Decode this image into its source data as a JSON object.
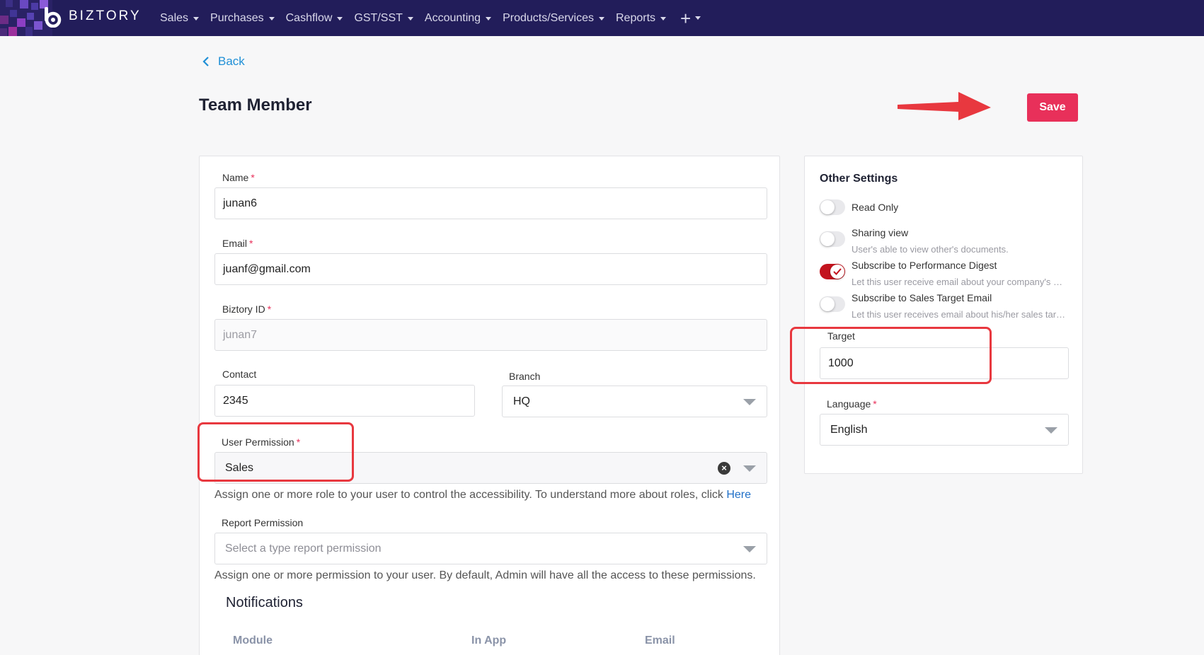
{
  "brand": {
    "name": "BIZTORY"
  },
  "nav": {
    "items": [
      {
        "label": "Sales"
      },
      {
        "label": "Purchases"
      },
      {
        "label": "Cashflow"
      },
      {
        "label": "GST/SST"
      },
      {
        "label": "Accounting"
      },
      {
        "label": "Products/Services"
      },
      {
        "label": "Reports"
      }
    ],
    "plus": "+"
  },
  "page": {
    "back_label": "Back",
    "title": "Team Member",
    "save_label": "Save"
  },
  "form": {
    "name": {
      "label": "Name",
      "required": "*",
      "value": "junan6"
    },
    "email": {
      "label": "Email",
      "required": "*",
      "value": "juanf@gmail.com"
    },
    "biztory_id": {
      "label": "Biztory ID",
      "required": "*",
      "value": "junan7"
    },
    "contact": {
      "label": "Contact",
      "value": "2345"
    },
    "branch": {
      "label": "Branch",
      "value": "HQ"
    },
    "user_permission": {
      "label": "User Permission",
      "required": "*",
      "value": "Sales",
      "help": "Assign one or more role to your user to control the accessibility. To understand more about roles, click ",
      "help_link": "Here"
    },
    "report_permission": {
      "label": "Report Permission",
      "placeholder": "Select a type report permission",
      "help": "Assign one or more permission to your user. By default, Admin will have all the access to these permissions."
    },
    "notifications": {
      "title": "Notifications",
      "columns": [
        "Module",
        "In App",
        "Email"
      ]
    }
  },
  "other_settings": {
    "title": "Other Settings",
    "options": [
      {
        "label": "Read Only",
        "description": "",
        "enabled": false
      },
      {
        "label": "Sharing view",
        "description": "User's able to view other's documents.",
        "enabled": false
      },
      {
        "label": "Subscribe to Performance Digest",
        "description": "Let this user receive email about your company's performance.",
        "enabled": true
      },
      {
        "label": "Subscribe to Sales Target Email",
        "description": "Let this user receives email about his/her sales target.",
        "enabled": false
      }
    ],
    "target": {
      "label": "Target",
      "value": "1000"
    },
    "language": {
      "label": "Language",
      "required": "*",
      "value": "English"
    }
  },
  "colors": {
    "navbar": "#221d5a",
    "accent": "#e8305a",
    "link": "#1f8fd6",
    "toggle_on": "#c3141e",
    "highlight": "#e8383f"
  }
}
